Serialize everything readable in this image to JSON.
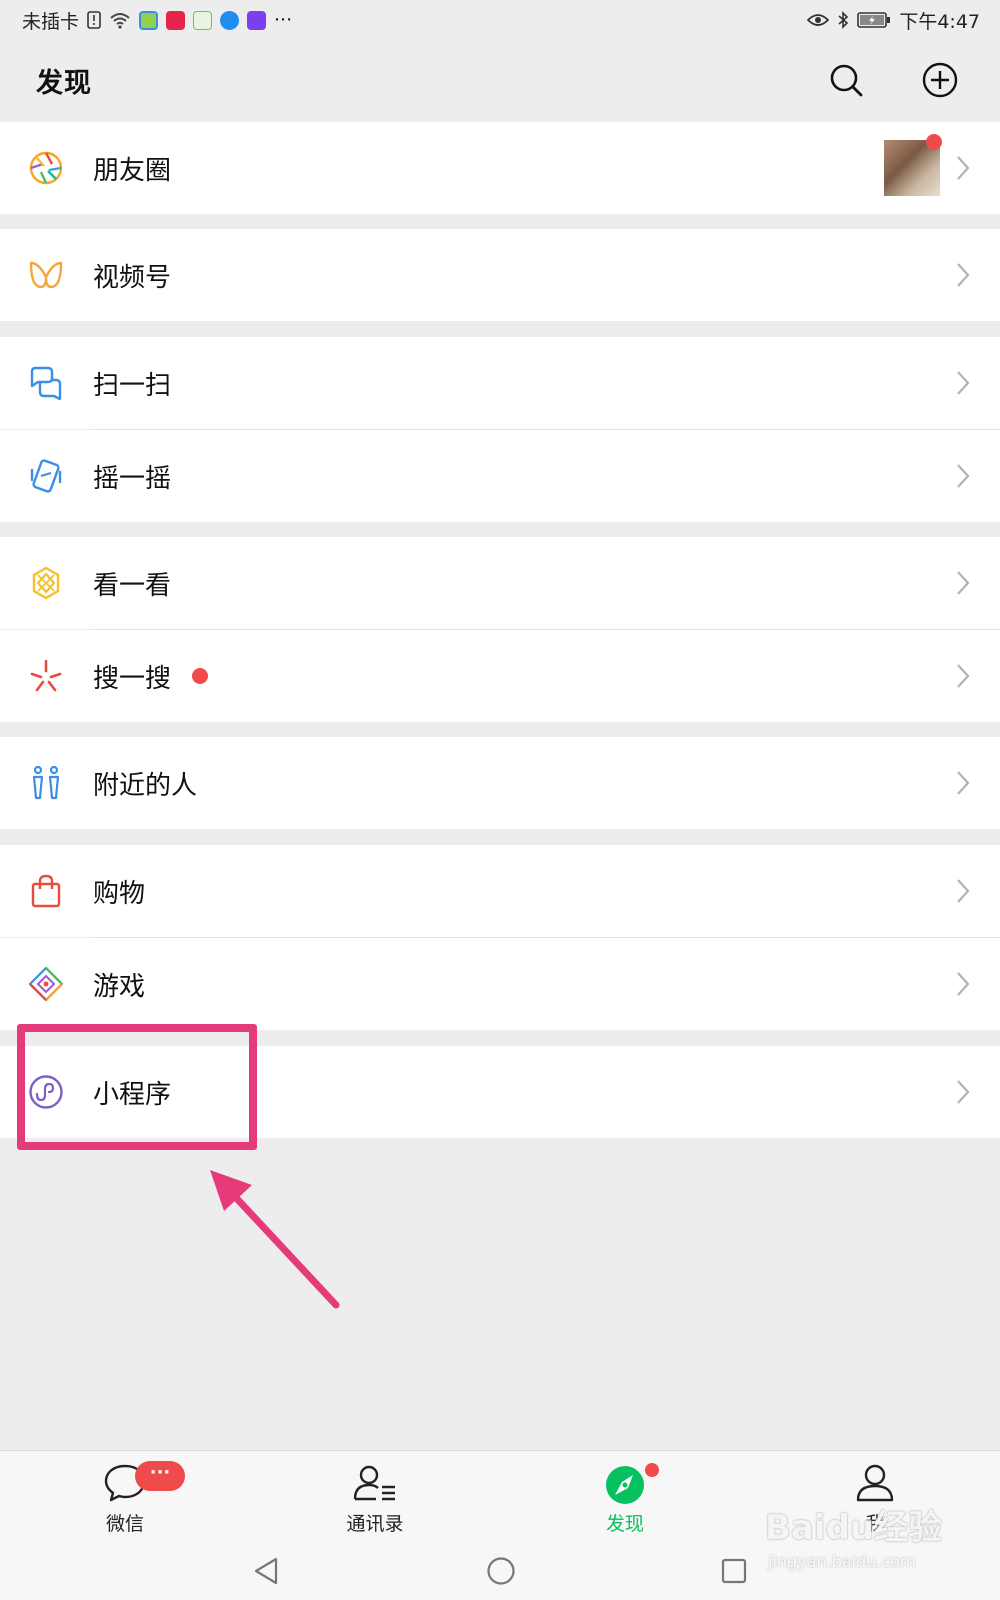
{
  "status_bar": {
    "carrier": "未插卡",
    "time": "下午4:47",
    "more": "···"
  },
  "header": {
    "title": "发现"
  },
  "menu": [
    {
      "label": "朋友圈",
      "icon": "moments-icon"
    },
    {
      "label": "视频号",
      "icon": "channels-icon"
    },
    {
      "label": "扫一扫",
      "icon": "scan-icon"
    },
    {
      "label": "摇一摇",
      "icon": "shake-icon"
    },
    {
      "label": "看一看",
      "icon": "top-stories-icon"
    },
    {
      "label": "搜一搜",
      "icon": "search-feature-icon"
    },
    {
      "label": "附近的人",
      "icon": "people-nearby-icon"
    },
    {
      "label": "购物",
      "icon": "shopping-icon"
    },
    {
      "label": "游戏",
      "icon": "games-icon"
    },
    {
      "label": "小程序",
      "icon": "mini-programs-icon"
    }
  ],
  "tabs": [
    {
      "label": "微信",
      "badge": "···",
      "active": false
    },
    {
      "label": "通讯录",
      "active": false
    },
    {
      "label": "发现",
      "active": true
    },
    {
      "label": "我",
      "active": false
    }
  ],
  "watermark": {
    "brand": "Baidu经验",
    "url": "jingyan.baidu.com"
  },
  "colors": {
    "accent_green": "#07c160",
    "badge_red": "#f04b4b",
    "highlight_pink": "#e63b7a",
    "page_bg": "#ededed"
  }
}
